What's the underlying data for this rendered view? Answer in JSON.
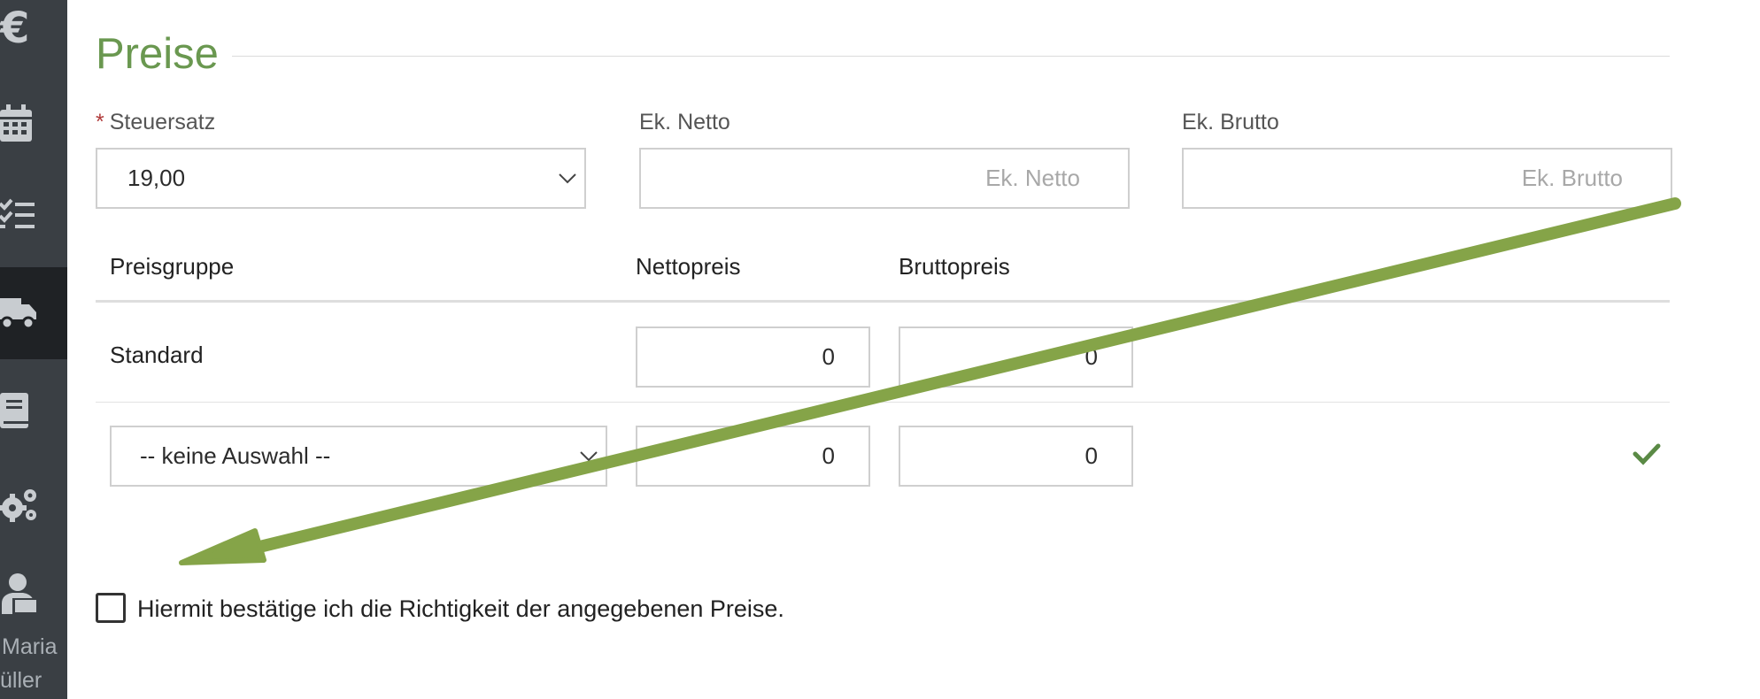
{
  "sidebar": {
    "currency_glyph": "€",
    "icons": [
      "euro-icon",
      "calendar-icon",
      "checklist-icon",
      "truck-icon",
      "book-icon",
      "gears-icon",
      "user-icon"
    ],
    "active_item": "truck-icon",
    "user_name_line1": "Maria",
    "user_name_line2": "üller"
  },
  "section": {
    "title": "Preise"
  },
  "fields": {
    "steuersatz": {
      "required_mark": "*",
      "label": "Steuersatz",
      "value": "19,00"
    },
    "ek_netto": {
      "label": "Ek. Netto",
      "placeholder": "Ek. Netto"
    },
    "ek_brutto": {
      "label": "Ek. Brutto",
      "placeholder": "Ek. Brutto"
    }
  },
  "table": {
    "headers": [
      "Preisgruppe",
      "Nettopreis",
      "Bruttopreis"
    ],
    "rows": [
      {
        "group": "Standard",
        "netto": "0",
        "brutto": "0"
      }
    ],
    "new_row": {
      "group_select": "-- keine Auswahl --",
      "netto": "0",
      "brutto": "0"
    }
  },
  "confirmation": {
    "label": "Hiermit bestätige ich die Richtigkeit der angegebenen Preise.",
    "checked": false
  },
  "colors": {
    "accent": "#6a9850",
    "arrow": "#85a448",
    "sidebar_bg": "#3a3f44",
    "sidebar_active": "#1f2225",
    "required": "#b03a3a"
  }
}
